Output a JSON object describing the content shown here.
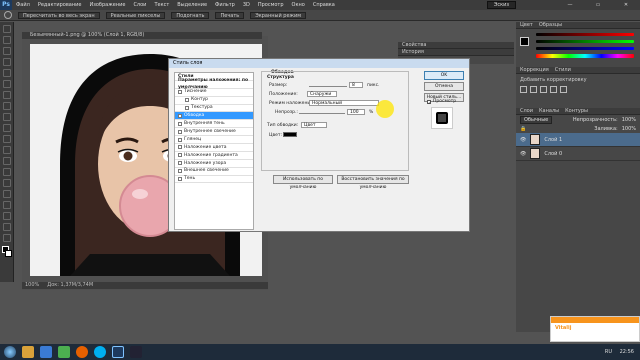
{
  "app": {
    "logo": "Ps",
    "menu": [
      "Файл",
      "Редактирование",
      "Изображение",
      "Слои",
      "Текст",
      "Выделение",
      "Фильтр",
      "3D",
      "Просмотр",
      "Окно",
      "Справка"
    ],
    "workspace": "Эскиз",
    "window_controls": [
      "—",
      "▭",
      "✕"
    ]
  },
  "options_bar": {
    "items": [
      "Пересчитать во весь экран",
      "Реальные пикселы",
      "Подогнать",
      "Печать",
      "Экранный режим"
    ]
  },
  "document": {
    "tab_title": "Безымянный-1.png @ 100% (Слой 1, RGB/8)",
    "zoom": "100%",
    "doc_info": "Док: 1,37M/3,74M"
  },
  "dialog": {
    "title": "Стиль слоя",
    "list": [
      {
        "label": "Стили",
        "head": true,
        "checkbox": false
      },
      {
        "label": "Параметры наложения: по умолчанию",
        "head": true,
        "checkbox": false
      },
      {
        "label": "Тиснение",
        "checkbox": true
      },
      {
        "label": "Контур",
        "checkbox": true,
        "sub": true
      },
      {
        "label": "Текстура",
        "checkbox": true,
        "sub": true
      },
      {
        "label": "Обводка",
        "checkbox": true,
        "selected": true
      },
      {
        "label": "Внутренняя тень",
        "checkbox": true
      },
      {
        "label": "Внутреннее свечение",
        "checkbox": true
      },
      {
        "label": "Глянец",
        "checkbox": true
      },
      {
        "label": "Наложение цвета",
        "checkbox": true
      },
      {
        "label": "Наложение градиента",
        "checkbox": true
      },
      {
        "label": "Наложение узора",
        "checkbox": true
      },
      {
        "label": "Внешнее свечение",
        "checkbox": true
      },
      {
        "label": "Тень",
        "checkbox": true
      }
    ],
    "section_title": "Обводка",
    "group_title": "Структура",
    "size_label": "Размер:",
    "size_value": "8",
    "size_unit": "пикс.",
    "position_label": "Положение:",
    "position_value": "Снаружи",
    "blend_label": "Режим наложения:",
    "blend_value": "Нормальный",
    "opacity_label": "Непрозр.:",
    "opacity_value": "100",
    "opacity_unit": "%",
    "fill_type_label": "Тип обводки:",
    "fill_type_value": "Цвет",
    "color_label": "Цвет:",
    "btn_default": "Использовать по умолчанию",
    "btn_restore": "Восстановить значения по умолчанию",
    "ok": "OK",
    "cancel": "Отмена",
    "new_style": "Новый стиль...",
    "preview": "Просмотр"
  },
  "right_panels": {
    "color_tabs": [
      "Цвет",
      "Образцы"
    ],
    "adjust_tabs": [
      "Коррекция",
      "Стили"
    ],
    "adjust_caption": "Добавить корректировку",
    "layers_tabs": [
      "Слои",
      "Каналы",
      "Контуры"
    ],
    "blend_mode": "Обычные",
    "opacity_label": "Непрозрачность:",
    "opacity_value": "100%",
    "fill_label": "Заливка:",
    "fill_value": "100%",
    "layers": [
      "Слой 1",
      "Слой 0"
    ],
    "history_tab": "История",
    "mid_tab": "Свойства"
  },
  "taskbar": {
    "lang": "RU",
    "time": "22:56",
    "notification_name": "Vitalij"
  },
  "colors": {
    "accent": "#3399ff",
    "stroke_color": "#000000",
    "panel_bg": "#474747"
  }
}
